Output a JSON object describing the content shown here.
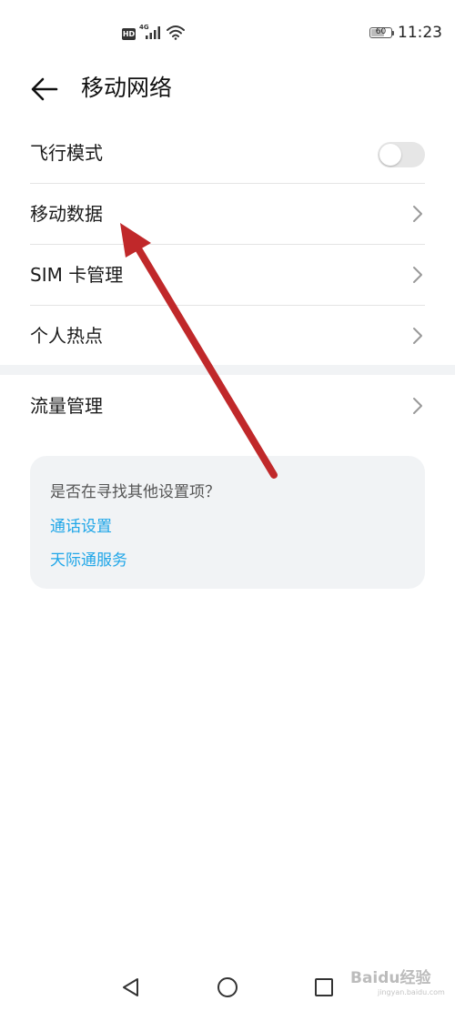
{
  "status_bar": {
    "hd_badge": "HD",
    "network_type": "4G",
    "battery_level": "60",
    "time": "11:23"
  },
  "header": {
    "title": "移动网络",
    "back_icon": "back-arrow-icon"
  },
  "settings": {
    "airplane_mode": {
      "label": "飞行模式",
      "enabled": false
    },
    "mobile_data": {
      "label": "移动数据"
    },
    "sim_management": {
      "label": "SIM 卡管理"
    },
    "hotspot": {
      "label": "个人热点"
    },
    "data_usage": {
      "label": "流量管理"
    }
  },
  "suggestion": {
    "question": "是否在寻找其他设置项？",
    "links": [
      "通话设置",
      "天际通服务"
    ]
  },
  "watermark": {
    "brand": "Baidu经验",
    "site": "jingyan.baidu.com"
  },
  "colors": {
    "link": "#1fa6e8",
    "annotation_arrow": "#c0282a",
    "card_background": "#f1f3f5"
  }
}
